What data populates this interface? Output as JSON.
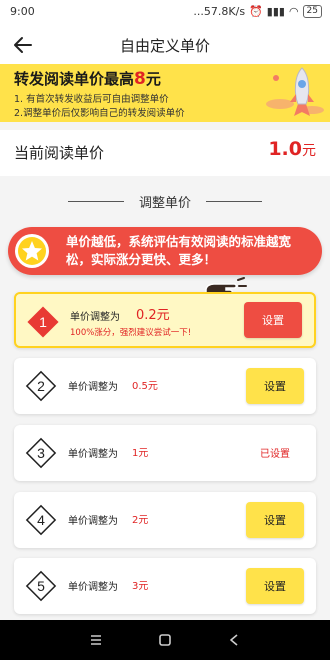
{
  "status": {
    "time": "9:00",
    "speed": "...57.8K/s",
    "battery": "25"
  },
  "header": {
    "title": "自由定义单价"
  },
  "banner": {
    "headline_prefix": "转发阅读单价最高",
    "headline_num": "8",
    "headline_suffix": "元",
    "line1": "1. 有首次转发收益后可自由调整单价",
    "line2": "2.调整单价后仅影响自己的转发阅读单价"
  },
  "current": {
    "label": "当前阅读单价",
    "value": "1.0",
    "unit": "元"
  },
  "section": {
    "title": "调整单价"
  },
  "tip": {
    "text": "单价越低，系统评估有效阅读的标准越宽松，实际涨分更快、更多！"
  },
  "options": [
    {
      "num": "1",
      "label": "单价调整为",
      "price": "0.2元",
      "sub": "100%涨分，强烈建议尝试一下!",
      "action": "设置"
    },
    {
      "num": "2",
      "label": "单价调整为",
      "price": "0.5元",
      "action": "设置"
    },
    {
      "num": "3",
      "label": "单价调整为",
      "price": "1元",
      "action": "已设置"
    },
    {
      "num": "4",
      "label": "单价调整为",
      "price": "2元",
      "action": "设置"
    },
    {
      "num": "5",
      "label": "单价调整为",
      "price": "3元",
      "action": "设置"
    }
  ],
  "icons": {
    "back": "arrow-left-icon",
    "star": "star-icon",
    "hand": "pointing-hand-icon",
    "rocket": "rocket-icon",
    "menu": "menu-icon",
    "home": "square-home-icon",
    "back_nav": "triangle-back-icon"
  },
  "colors": {
    "accent_yellow": "#ffe24a",
    "accent_red": "#ee4d42",
    "price_red": "#e02424"
  }
}
